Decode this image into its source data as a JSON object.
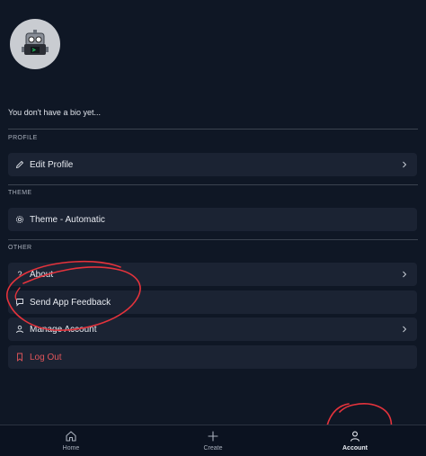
{
  "profile": {
    "bio": "You don't have a bio yet..."
  },
  "sections": {
    "profile_label": "PROFILE",
    "theme_label": "THEME",
    "other_label": "OTHER"
  },
  "rows": {
    "edit_profile": "Edit Profile",
    "theme": "Theme - Automatic",
    "about": "About",
    "send_feedback": "Send App Feedback",
    "manage_account": "Manage Account",
    "log_out": "Log Out"
  },
  "tabbar": {
    "home": "Home",
    "create": "Create",
    "account": "Account"
  },
  "colors": {
    "background": "#0f1725",
    "row": "#1b2333",
    "danger": "#e0555a",
    "annotation": "#e4333c"
  },
  "icons": {
    "avatar": "robot-icon",
    "edit_profile": "pencil-icon",
    "theme": "gear-icon",
    "about": "question-icon",
    "send_feedback": "chat-bubble-icon",
    "manage_account": "user-icon",
    "log_out": "bookmark-icon",
    "chevron": "chevron-right-icon",
    "home": "home-icon",
    "create": "plus-icon",
    "account": "user-icon"
  }
}
